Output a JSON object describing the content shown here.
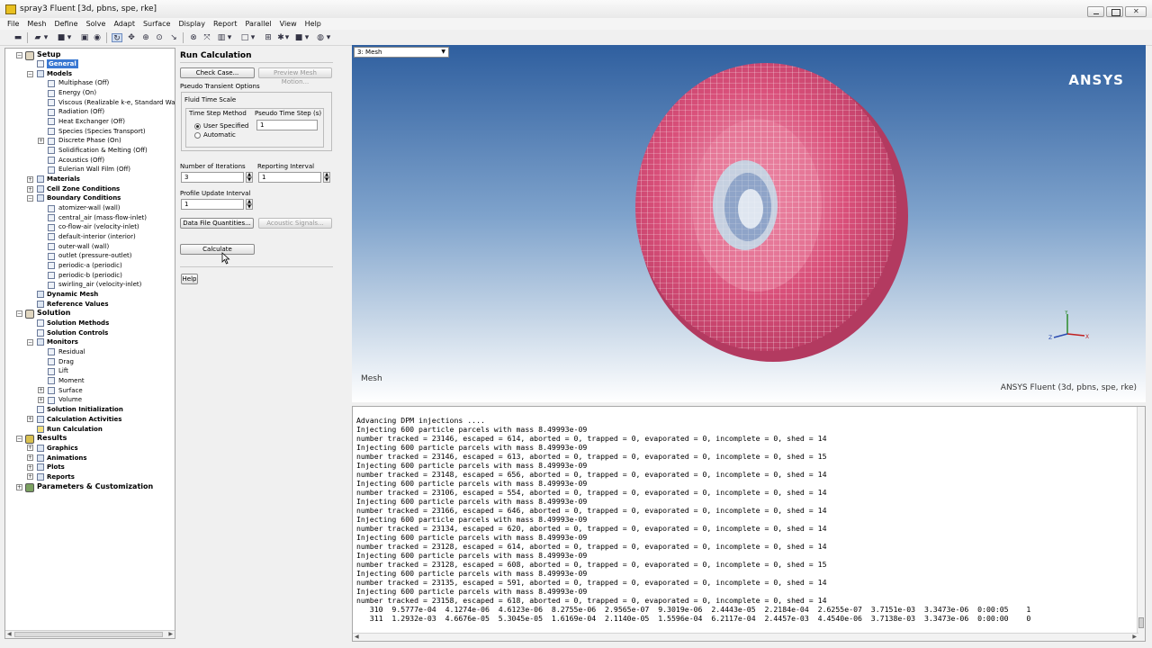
{
  "window": {
    "title": "spray3 Fluent [3d, pbns, spe, rke]"
  },
  "menu": [
    "File",
    "Mesh",
    "Define",
    "Solve",
    "Adapt",
    "Surface",
    "Display",
    "Report",
    "Parallel",
    "View",
    "Help"
  ],
  "tree": {
    "setup": "Setup",
    "general": "General",
    "models": "Models",
    "models_items": [
      "Multiphase (Off)",
      "Energy (On)",
      "Viscous (Realizable k-e, Standard Wall",
      "Radiation (Off)",
      "Heat Exchanger (Off)",
      "Species (Species Transport)",
      "Discrete Phase (On)",
      "Solidification & Melting (Off)",
      "Acoustics (Off)",
      "Eulerian Wall Film (Off)"
    ],
    "materials": "Materials",
    "cell_zone": "Cell Zone Conditions",
    "boundary": "Boundary Conditions",
    "boundary_items": [
      "atomizer-wall (wall)",
      "central_air (mass-flow-inlet)",
      "co-flow-air (velocity-inlet)",
      "default-interior (interior)",
      "outer-wall (wall)",
      "outlet (pressure-outlet)",
      "periodic-a (periodic)",
      "periodic-b (periodic)",
      "swirling_air (velocity-inlet)"
    ],
    "dynamic_mesh": "Dynamic Mesh",
    "reference_values": "Reference Values",
    "solution": "Solution",
    "solution_methods": "Solution Methods",
    "solution_controls": "Solution Controls",
    "monitors": "Monitors",
    "monitors_items": [
      "Residual",
      "Drag",
      "Lift",
      "Moment",
      "Surface",
      "Volume"
    ],
    "solution_init": "Solution Initialization",
    "calc_activities": "Calculation Activities",
    "run_calc": "Run Calculation",
    "results": "Results",
    "results_items": [
      "Graphics",
      "Animations",
      "Plots",
      "Reports"
    ],
    "params": "Parameters & Customization"
  },
  "panel": {
    "title": "Run Calculation",
    "check_case": "Check Case...",
    "preview_mesh": "Preview Mesh Motion...",
    "pseudo_options": "Pseudo Transient Options",
    "fluid_time_scale": "Fluid Time Scale",
    "time_step_method": "Time Step Method",
    "pseudo_time_step": "Pseudo Time Step (s)",
    "user_specified": "User Specified",
    "automatic": "Automatic",
    "pseudo_value": "1",
    "num_iterations_label": "Number of Iterations",
    "num_iterations": "3",
    "reporting_interval_label": "Reporting Interval",
    "reporting_interval": "1",
    "profile_update_label": "Profile Update Interval",
    "profile_update": "1",
    "data_file_quantities": "Data File Quantities...",
    "acoustic_signals": "Acoustic Signals...",
    "calculate": "Calculate",
    "help": "Help"
  },
  "graphics": {
    "selector": "3: Mesh",
    "brand": "ANSYS",
    "caption": "Mesh",
    "footer": "ANSYS Fluent (3d, pbns, spe, rke)",
    "mesh_color": "#d9507a"
  },
  "console": {
    "lines": [
      "Advancing DPM injections ....",
      "Injecting 600 particle parcels with mass 8.49993e-09",
      "number tracked = 23146, escaped = 614, aborted = 0, trapped = 0, evaporated = 0, incomplete = 0, shed = 14",
      "Injecting 600 particle parcels with mass 8.49993e-09",
      "number tracked = 23146, escaped = 613, aborted = 0, trapped = 0, evaporated = 0, incomplete = 0, shed = 15",
      "Injecting 600 particle parcels with mass 8.49993e-09",
      "number tracked = 23148, escaped = 656, aborted = 0, trapped = 0, evaporated = 0, incomplete = 0, shed = 14",
      "Injecting 600 particle parcels with mass 8.49993e-09",
      "number tracked = 23106, escaped = 554, aborted = 0, trapped = 0, evaporated = 0, incomplete = 0, shed = 14",
      "Injecting 600 particle parcels with mass 8.49993e-09",
      "number tracked = 23166, escaped = 646, aborted = 0, trapped = 0, evaporated = 0, incomplete = 0, shed = 14",
      "Injecting 600 particle parcels with mass 8.49993e-09",
      "number tracked = 23134, escaped = 620, aborted = 0, trapped = 0, evaporated = 0, incomplete = 0, shed = 14",
      "Injecting 600 particle parcels with mass 8.49993e-09",
      "number tracked = 23128, escaped = 614, aborted = 0, trapped = 0, evaporated = 0, incomplete = 0, shed = 14",
      "Injecting 600 particle parcels with mass 8.49993e-09",
      "number tracked = 23128, escaped = 608, aborted = 0, trapped = 0, evaporated = 0, incomplete = 0, shed = 15",
      "Injecting 600 particle parcels with mass 8.49993e-09",
      "number tracked = 23135, escaped = 591, aborted = 0, trapped = 0, evaporated = 0, incomplete = 0, shed = 14",
      "Injecting 600 particle parcels with mass 8.49993e-09",
      "number tracked = 23158, escaped = 618, aborted = 0, trapped = 0, evaporated = 0, incomplete = 0, shed = 14",
      "   310  9.5777e-04  4.1274e-06  4.6123e-06  8.2755e-06  2.9565e-07  9.3019e-06  2.4443e-05  2.2184e-04  2.6255e-07  3.7151e-03  3.3473e-06  0:00:05    1",
      "   311  1.2932e-03  4.6676e-05  5.3045e-05  1.6169e-04  2.1140e-05  1.5596e-04  6.2117e-04  2.4457e-03  4.4540e-06  3.7138e-03  3.3473e-06  0:00:00    0"
    ]
  }
}
